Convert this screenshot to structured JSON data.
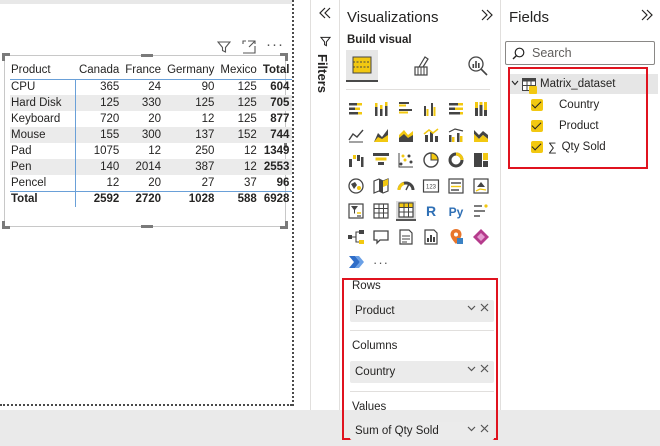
{
  "canvas": {
    "visual_icons": [
      "filter-icon",
      "focus-mode-icon",
      "more-options-icon"
    ]
  },
  "matrix": {
    "row_header": "Product",
    "columns": [
      "Canada",
      "France",
      "Germany",
      "Mexico"
    ],
    "total_label": "Total",
    "rows": [
      {
        "label": "CPU",
        "values": [
          "365",
          "24",
          "90",
          "125"
        ],
        "total": "604"
      },
      {
        "label": "Hard Disk",
        "values": [
          "125",
          "330",
          "125",
          "125"
        ],
        "total": "705"
      },
      {
        "label": "Keyboard",
        "values": [
          "720",
          "20",
          "12",
          "125"
        ],
        "total": "877"
      },
      {
        "label": "Mouse",
        "values": [
          "155",
          "300",
          "137",
          "152"
        ],
        "total": "744"
      },
      {
        "label": "Pad",
        "values": [
          "1075",
          "12",
          "250",
          "12"
        ],
        "total": "1349"
      },
      {
        "label": "Pen",
        "values": [
          "140",
          "2014",
          "387",
          "12"
        ],
        "total": "2553"
      },
      {
        "label": "Pencel",
        "values": [
          "12",
          "20",
          "27",
          "37"
        ],
        "total": "96"
      }
    ],
    "totals": {
      "label": "Total",
      "values": [
        "2592",
        "2720",
        "1028",
        "588"
      ],
      "total": "6928"
    }
  },
  "filters": {
    "label": "Filters"
  },
  "visualizations": {
    "title": "Visualizations",
    "build_label": "Build visual",
    "more_label": "···",
    "wells": [
      {
        "label": "Rows",
        "field": "Product"
      },
      {
        "label": "Columns",
        "field": "Country"
      },
      {
        "label": "Values",
        "field": "Sum of Qty Sold"
      }
    ],
    "accent_color": "#e0131f"
  },
  "fields": {
    "title": "Fields",
    "search_placeholder": "Search",
    "dataset": "Matrix_dataset",
    "items": [
      {
        "name": "Country",
        "checked": true,
        "sigma": false
      },
      {
        "name": "Product",
        "checked": true,
        "sigma": false
      },
      {
        "name": "Qty Sold",
        "checked": true,
        "sigma": true,
        "sigma_glyph": "∑"
      }
    ],
    "checkbox_color": "#f2c811"
  }
}
